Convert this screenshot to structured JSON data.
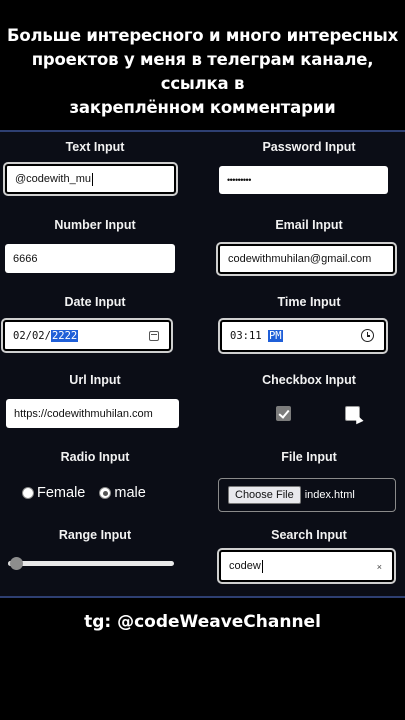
{
  "caption": {
    "line1": "Больше интересного и много интересных",
    "line2": "проектов у меня в телеграм канале, ссылка в",
    "line3": "закреплённом комментарии"
  },
  "form": {
    "text_input": {
      "label": "Text Input",
      "value": "@codewith_mu"
    },
    "password_input": {
      "label": "Password Input",
      "value": "•••••••••"
    },
    "number_input": {
      "label": "Number Input",
      "value": "6666"
    },
    "email_input": {
      "label": "Email Input",
      "value": "codewithmuhilan@gmail.com"
    },
    "date_input": {
      "label": "Date Input",
      "value_prefix": "02/02/",
      "value_selected": "2222"
    },
    "time_input": {
      "label": "Time Input",
      "value_prefix": "03:11 ",
      "value_selected": "PM"
    },
    "url_input": {
      "label": "Url Input",
      "value": "https://codewithmuhilan.com"
    },
    "checkbox_input": {
      "label": "Checkbox Input",
      "checkbox1_checked": true,
      "checkbox2_checked": false
    },
    "radio_input": {
      "label": "Radio Input",
      "options": [
        "Female",
        "male"
      ],
      "selected": "male"
    },
    "file_input": {
      "label": "File Input",
      "button_label": "Choose File",
      "file_name": "index.html"
    },
    "range_input": {
      "label": "Range Input",
      "value_fraction": 0.05
    },
    "search_input": {
      "label": "Search Input",
      "value": "codew",
      "clear_glyph": "×"
    }
  },
  "footer": {
    "text": "tg: @codeWeaveChannel"
  },
  "colors": {
    "panel_bg": "#0b0d16",
    "panel_border": "#2e3f72",
    "selection": "#1f5fd8"
  }
}
